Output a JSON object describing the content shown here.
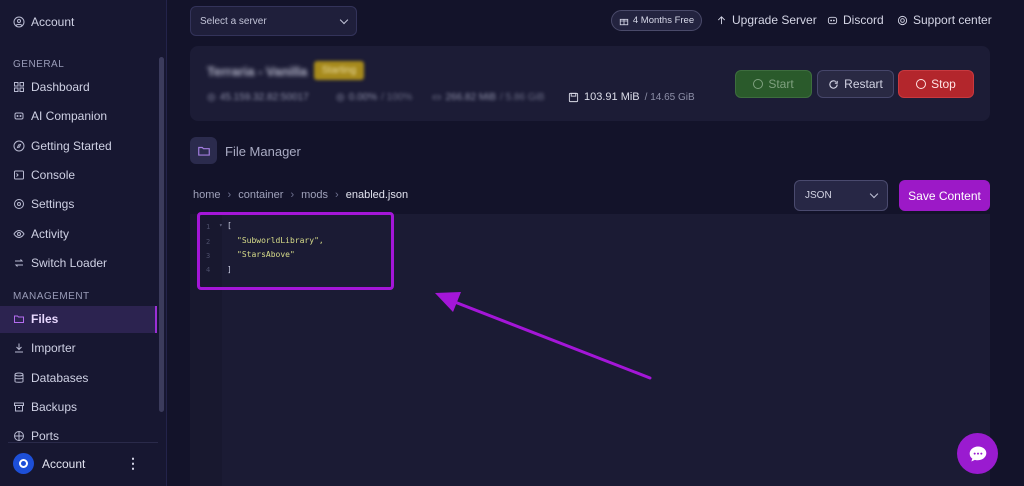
{
  "sidebar": {
    "account_top": "Account",
    "section_general": "GENERAL",
    "section_management": "MANAGEMENT",
    "general_items": [
      {
        "label": "Dashboard",
        "icon": "grid-icon"
      },
      {
        "label": "AI Companion",
        "icon": "chat-bot-icon"
      },
      {
        "label": "Getting Started",
        "icon": "compass-icon"
      },
      {
        "label": "Console",
        "icon": "terminal-icon"
      },
      {
        "label": "Settings",
        "icon": "gear-icon"
      },
      {
        "label": "Activity",
        "icon": "eye-icon"
      },
      {
        "label": "Switch Loader",
        "icon": "switch-icon"
      }
    ],
    "management_items": [
      {
        "label": "Files",
        "icon": "folder-icon",
        "active": true
      },
      {
        "label": "Importer",
        "icon": "download-icon"
      },
      {
        "label": "Databases",
        "icon": "database-icon"
      },
      {
        "label": "Backups",
        "icon": "archive-icon"
      },
      {
        "label": "Ports",
        "icon": "plug-icon"
      }
    ],
    "account_bottom": "Account",
    "kebab": "⋮"
  },
  "topbar": {
    "server_select_placeholder": "Select a server",
    "promo": "4 Months Free",
    "upgrade": "Upgrade Server",
    "discord": "Discord",
    "support": "Support center"
  },
  "server": {
    "name": "Terraria - Vanilla",
    "status": "Starting",
    "address": "45.159.32.82:50017",
    "cpu": "0.00%",
    "cpu_limit": "/ 100%",
    "memory": "266.82 MiB",
    "memory_limit": "/ 5.86 GiB",
    "disk": "103.91 MiB",
    "disk_limit": "/ 14.65 GiB",
    "start_label": "Start",
    "restart_label": "Restart",
    "stop_label": "Stop"
  },
  "file_manager": {
    "title": "File Manager",
    "breadcrumbs": [
      "home",
      "container",
      "mods",
      "enabled.json"
    ],
    "language": "JSON",
    "save_label": "Save Content"
  },
  "editor": {
    "line_numbers": [
      "1",
      "2",
      "3",
      "4"
    ],
    "lines": [
      "[",
      "\"SubworldLibrary\",",
      "\"StarsAbove\"",
      "]"
    ]
  },
  "colors": {
    "accent": "#9c19c7",
    "stop": "#b3262c",
    "start": "#2a5a2b",
    "annotation": "#a416d8"
  }
}
